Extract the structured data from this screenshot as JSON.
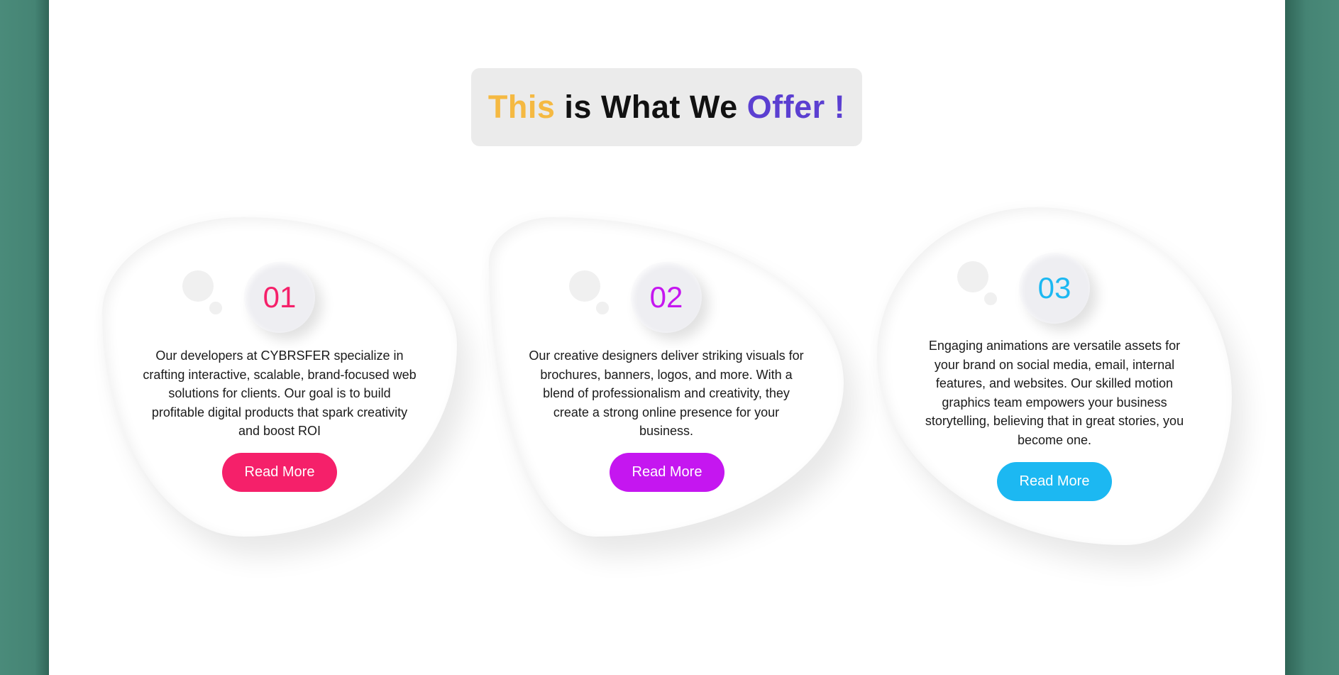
{
  "heading": {
    "word1": "This",
    "word2": " is What We ",
    "word3": "Offer !",
    "colors": {
      "word1": "#f5b942",
      "word2": "#111111",
      "word3": "#5b3fd1"
    }
  },
  "services": [
    {
      "number": "01",
      "description": "Our developers at CYBRSFER specialize in crafting interactive, scalable, brand-focused web solutions for clients. Our goal is to build profitable digital products that spark creativity and boost ROI",
      "button_label": "Read More",
      "accent_color": "#f5206a"
    },
    {
      "number": "02",
      "description": "Our creative designers deliver striking visuals for brochures, banners, logos, and more. With a blend of professionalism and creativity, they create a strong online presence for your business.",
      "button_label": "Read More",
      "accent_color": "#c516f0"
    },
    {
      "number": "03",
      "description": "Engaging animations are versatile assets for your brand on social media, email, internal features, and websites. Our skilled motion graphics team empowers your business storytelling, believing that in great stories, you become one.",
      "button_label": "Read More",
      "accent_color": "#1cb8f2"
    }
  ],
  "colors": {
    "background": "#438272",
    "page": "#ffffff",
    "heading_box": "#ebebeb"
  }
}
